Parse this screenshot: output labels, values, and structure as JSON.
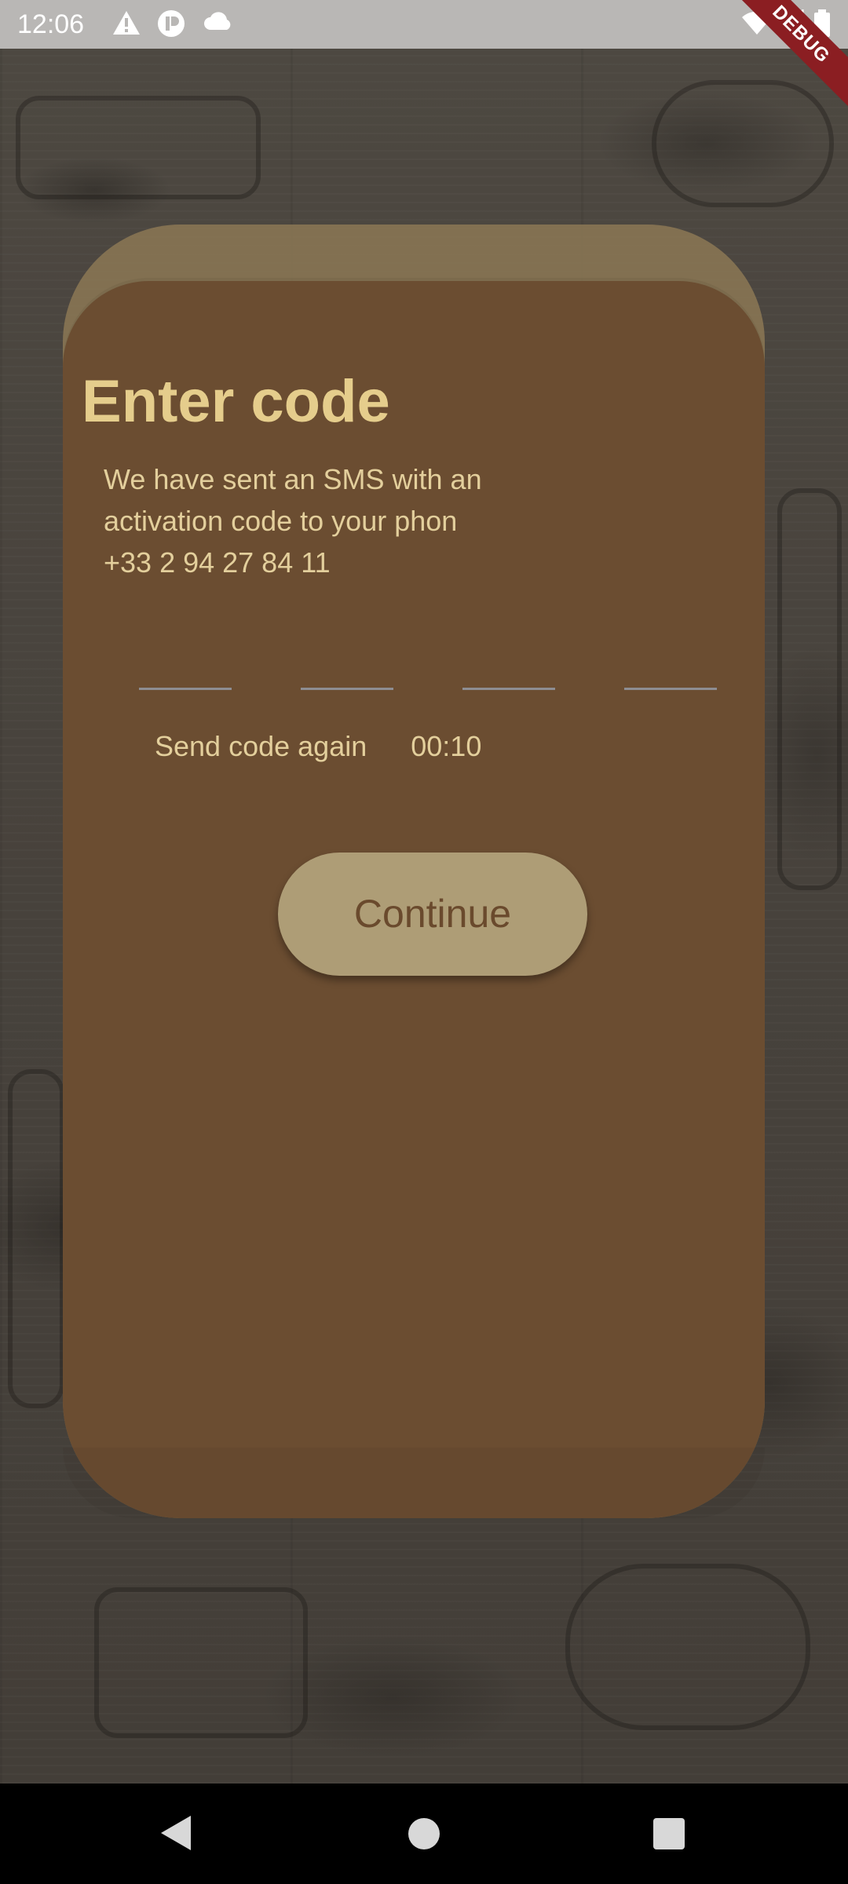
{
  "status_bar": {
    "time": "12:06",
    "icons": [
      "warning-icon",
      "app-notification-icon",
      "cloud-icon",
      "wifi-icon",
      "signal-icon",
      "battery-icon"
    ],
    "debug_label": "DEBUG"
  },
  "screen": {
    "title": "Enter code",
    "description_lines": [
      "We have sent an SMS with an",
      "activation code to your phon",
      "+33 2 94 27 84 11"
    ],
    "code_fields": [
      {
        "value": ""
      },
      {
        "value": ""
      },
      {
        "value": ""
      },
      {
        "value": ""
      }
    ],
    "resend_label": "Send code again",
    "timer": "00:10",
    "continue_label": "Continue"
  },
  "colors": {
    "card": "#6b4d31",
    "title": "#e5cd8c",
    "text": "#e3cf9c",
    "button": "#ae9d76",
    "button_text": "#6a4a2d"
  },
  "nav_bar": {
    "icons": [
      "back-icon",
      "home-icon",
      "recents-icon"
    ]
  }
}
